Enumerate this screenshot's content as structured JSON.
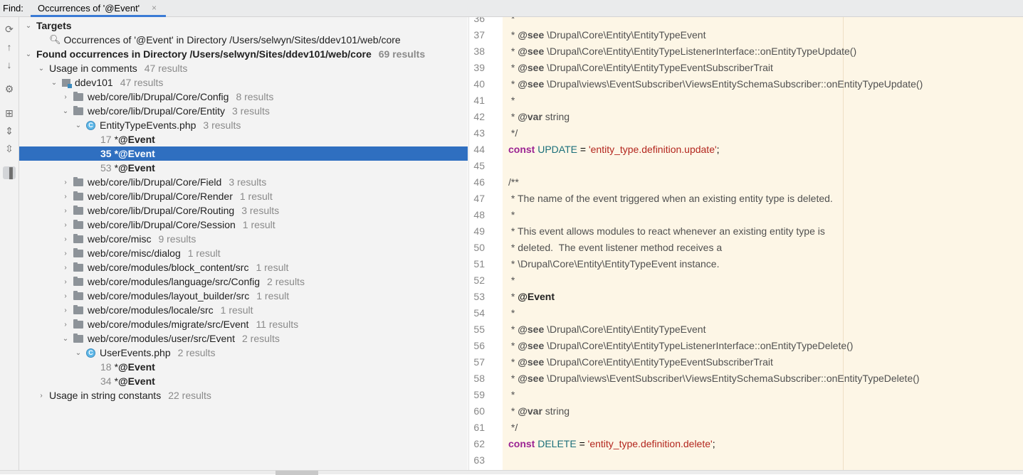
{
  "header": {
    "find_label": "Find:",
    "tab_label": "Occurrences of '@Event'",
    "tab_close": "×"
  },
  "toolbar": {
    "icons": [
      "refresh-icon",
      "arrow-up-icon",
      "arrow-down-icon",
      "gear-icon",
      "group-icon",
      "expand-icon",
      "collapse-icon",
      "preview-icon"
    ]
  },
  "tree": {
    "targets_label": "Targets",
    "target_item": "Occurrences of '@Event' in Directory /Users/selwyn/Sites/ddev101/web/core",
    "found_label": "Found occurrences in Directory /Users/selwyn/Sites/ddev101/web/core",
    "found_count": "69 results",
    "usage_comments": "Usage in comments",
    "usage_comments_count": "47 results",
    "module": "ddev101",
    "module_count": "47 results",
    "folders": [
      {
        "label": "web/core/lib/Drupal/Core/Config",
        "count": "8 results"
      },
      {
        "label": "web/core/lib/Drupal/Core/Entity",
        "count": "3 results"
      },
      {
        "label": "web/core/lib/Drupal/Core/Field",
        "count": "3 results"
      },
      {
        "label": "web/core/lib/Drupal/Core/Render",
        "count": "1 result"
      },
      {
        "label": "web/core/lib/Drupal/Core/Routing",
        "count": "3 results"
      },
      {
        "label": "web/core/lib/Drupal/Core/Session",
        "count": "1 result"
      },
      {
        "label": "web/core/misc",
        "count": "9 results"
      },
      {
        "label": "web/core/misc/dialog",
        "count": "1 result"
      },
      {
        "label": "web/core/modules/block_content/src",
        "count": "1 result"
      },
      {
        "label": "web/core/modules/language/src/Config",
        "count": "2 results"
      },
      {
        "label": "web/core/modules/layout_builder/src",
        "count": "1 result"
      },
      {
        "label": "web/core/modules/locale/src",
        "count": "1 result"
      },
      {
        "label": "web/core/modules/migrate/src/Event",
        "count": "11 results"
      },
      {
        "label": "web/core/modules/user/src/Event",
        "count": "2 results"
      }
    ],
    "file1": {
      "label": "EntityTypeEvents.php",
      "count": "3 results"
    },
    "file1_hits": [
      {
        "line": "17",
        "prefix": "* ",
        "text": "@Event"
      },
      {
        "line": "35",
        "prefix": "* ",
        "text": "@Event"
      },
      {
        "line": "53",
        "prefix": "* ",
        "text": "@Event"
      }
    ],
    "file2": {
      "label": "UserEvents.php",
      "count": "2 results"
    },
    "file2_hits": [
      {
        "line": "18",
        "prefix": "* ",
        "text": "@Event"
      },
      {
        "line": "34",
        "prefix": "* ",
        "text": "@Event"
      }
    ],
    "usage_strings": "Usage in string constants",
    "usage_strings_count": "22 results"
  },
  "editor": {
    "line_numbers": [
      "36",
      "37",
      "38",
      "39",
      "40",
      "41",
      "42",
      "43",
      "44",
      "45",
      "46",
      "47",
      "48",
      "49",
      "50",
      "51",
      "52",
      "53",
      "54",
      "55",
      "56",
      "57",
      "58",
      "59",
      "60",
      "61",
      "62",
      "63"
    ],
    "see_tag": "@see",
    "var_tag": "@var",
    "event_tag": "@Event",
    "kw_const": "const",
    "c_star": " *",
    "c_end": " */",
    "c_open": "/**",
    "see_1": " \\Drupal\\Core\\Entity\\EntityTypeEvent",
    "see_2": " \\Drupal\\Core\\Entity\\EntityTypeListenerInterface::onEntityTypeUpdate()",
    "see_3": " \\Drupal\\Core\\Entity\\EntityTypeEventSubscriberTrait",
    "see_4": " \\Drupal\\views\\EventSubscriber\\ViewsEntitySchemaSubscriber::onEntityTypeUpdate()",
    "var_type": " string",
    "update_name": "UPDATE",
    "update_value": "'entity_type.definition.update'",
    "delete_name": "DELETE",
    "delete_value": "'entity_type.definition.delete'",
    "eq": " = ",
    "semi": ";",
    "doc_47": " * The name of the event triggered when an existing entity type is deleted.",
    "doc_49": " * This event allows modules to react whenever an existing entity type is",
    "doc_50": " * deleted.  The event listener method receives a",
    "doc_51": " * \\Drupal\\Core\\Entity\\EntityTypeEvent instance.",
    "see_5": " \\Drupal\\Core\\Entity\\EntityTypeEvent",
    "see_6": " \\Drupal\\Core\\Entity\\EntityTypeListenerInterface::onEntityTypeDelete()",
    "see_7": " \\Drupal\\Core\\Entity\\EntityTypeEventSubscriberTrait",
    "see_8": " \\Drupal\\views\\EventSubscriber\\ViewsEntitySchemaSubscriber::onEntityTypeDelete()"
  }
}
